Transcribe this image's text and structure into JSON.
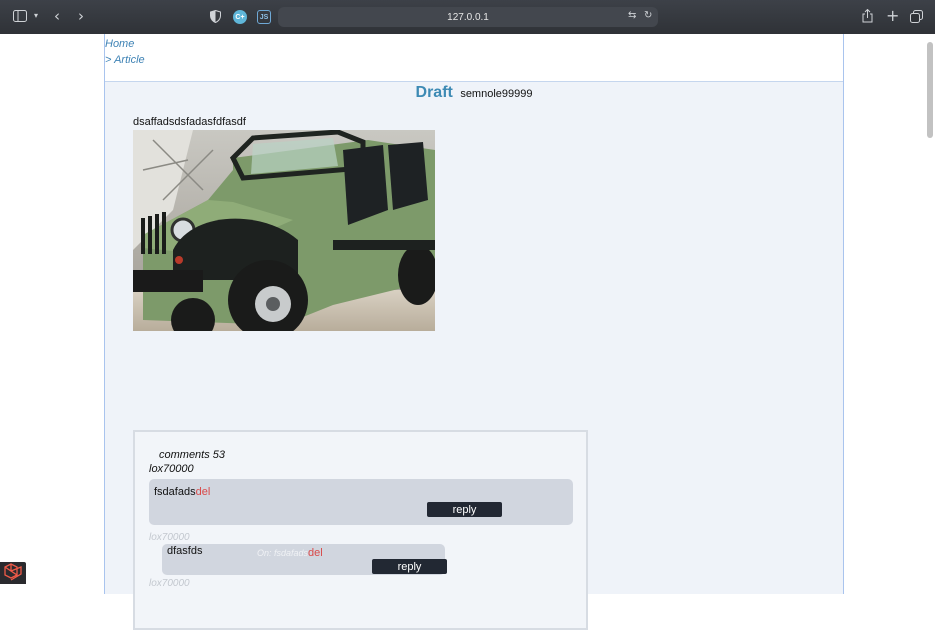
{
  "browser": {
    "url": "127.0.0.1",
    "icons": {
      "sidebar": "sidebar-icon",
      "chevron": "chevron-down-icon",
      "back": "back-icon",
      "forward": "forward-icon",
      "shield": "shield-icon",
      "ext1": "extension-icon",
      "ext2": "js-extension-icon",
      "translate": "translate-icon",
      "reload": "reload-icon",
      "share": "share-icon",
      "new_tab": "plus-icon",
      "tabs": "tabs-overview-icon"
    },
    "ext1_label": "C+",
    "ext2_label": "JS"
  },
  "breadcrumb": {
    "home": "Home",
    "article": "> Article"
  },
  "article": {
    "status": "Draft",
    "author": "semnole99999",
    "body": "dsaffadsdsfadasfdfasdf"
  },
  "comments": {
    "count_label": "comments 53",
    "items": [
      {
        "author": "lox70000",
        "text": "fsdafads",
        "del_label": "del",
        "reply_label": "reply"
      },
      {
        "author": "lox70000",
        "text": "dfasfds",
        "on_label": "On: fsdafads",
        "del_label": "del",
        "reply_label": "reply"
      }
    ],
    "next_author": "lox70000"
  },
  "colors": {
    "accent": "#3d8ab4",
    "del": "#d94a4a",
    "button": "#222833"
  }
}
